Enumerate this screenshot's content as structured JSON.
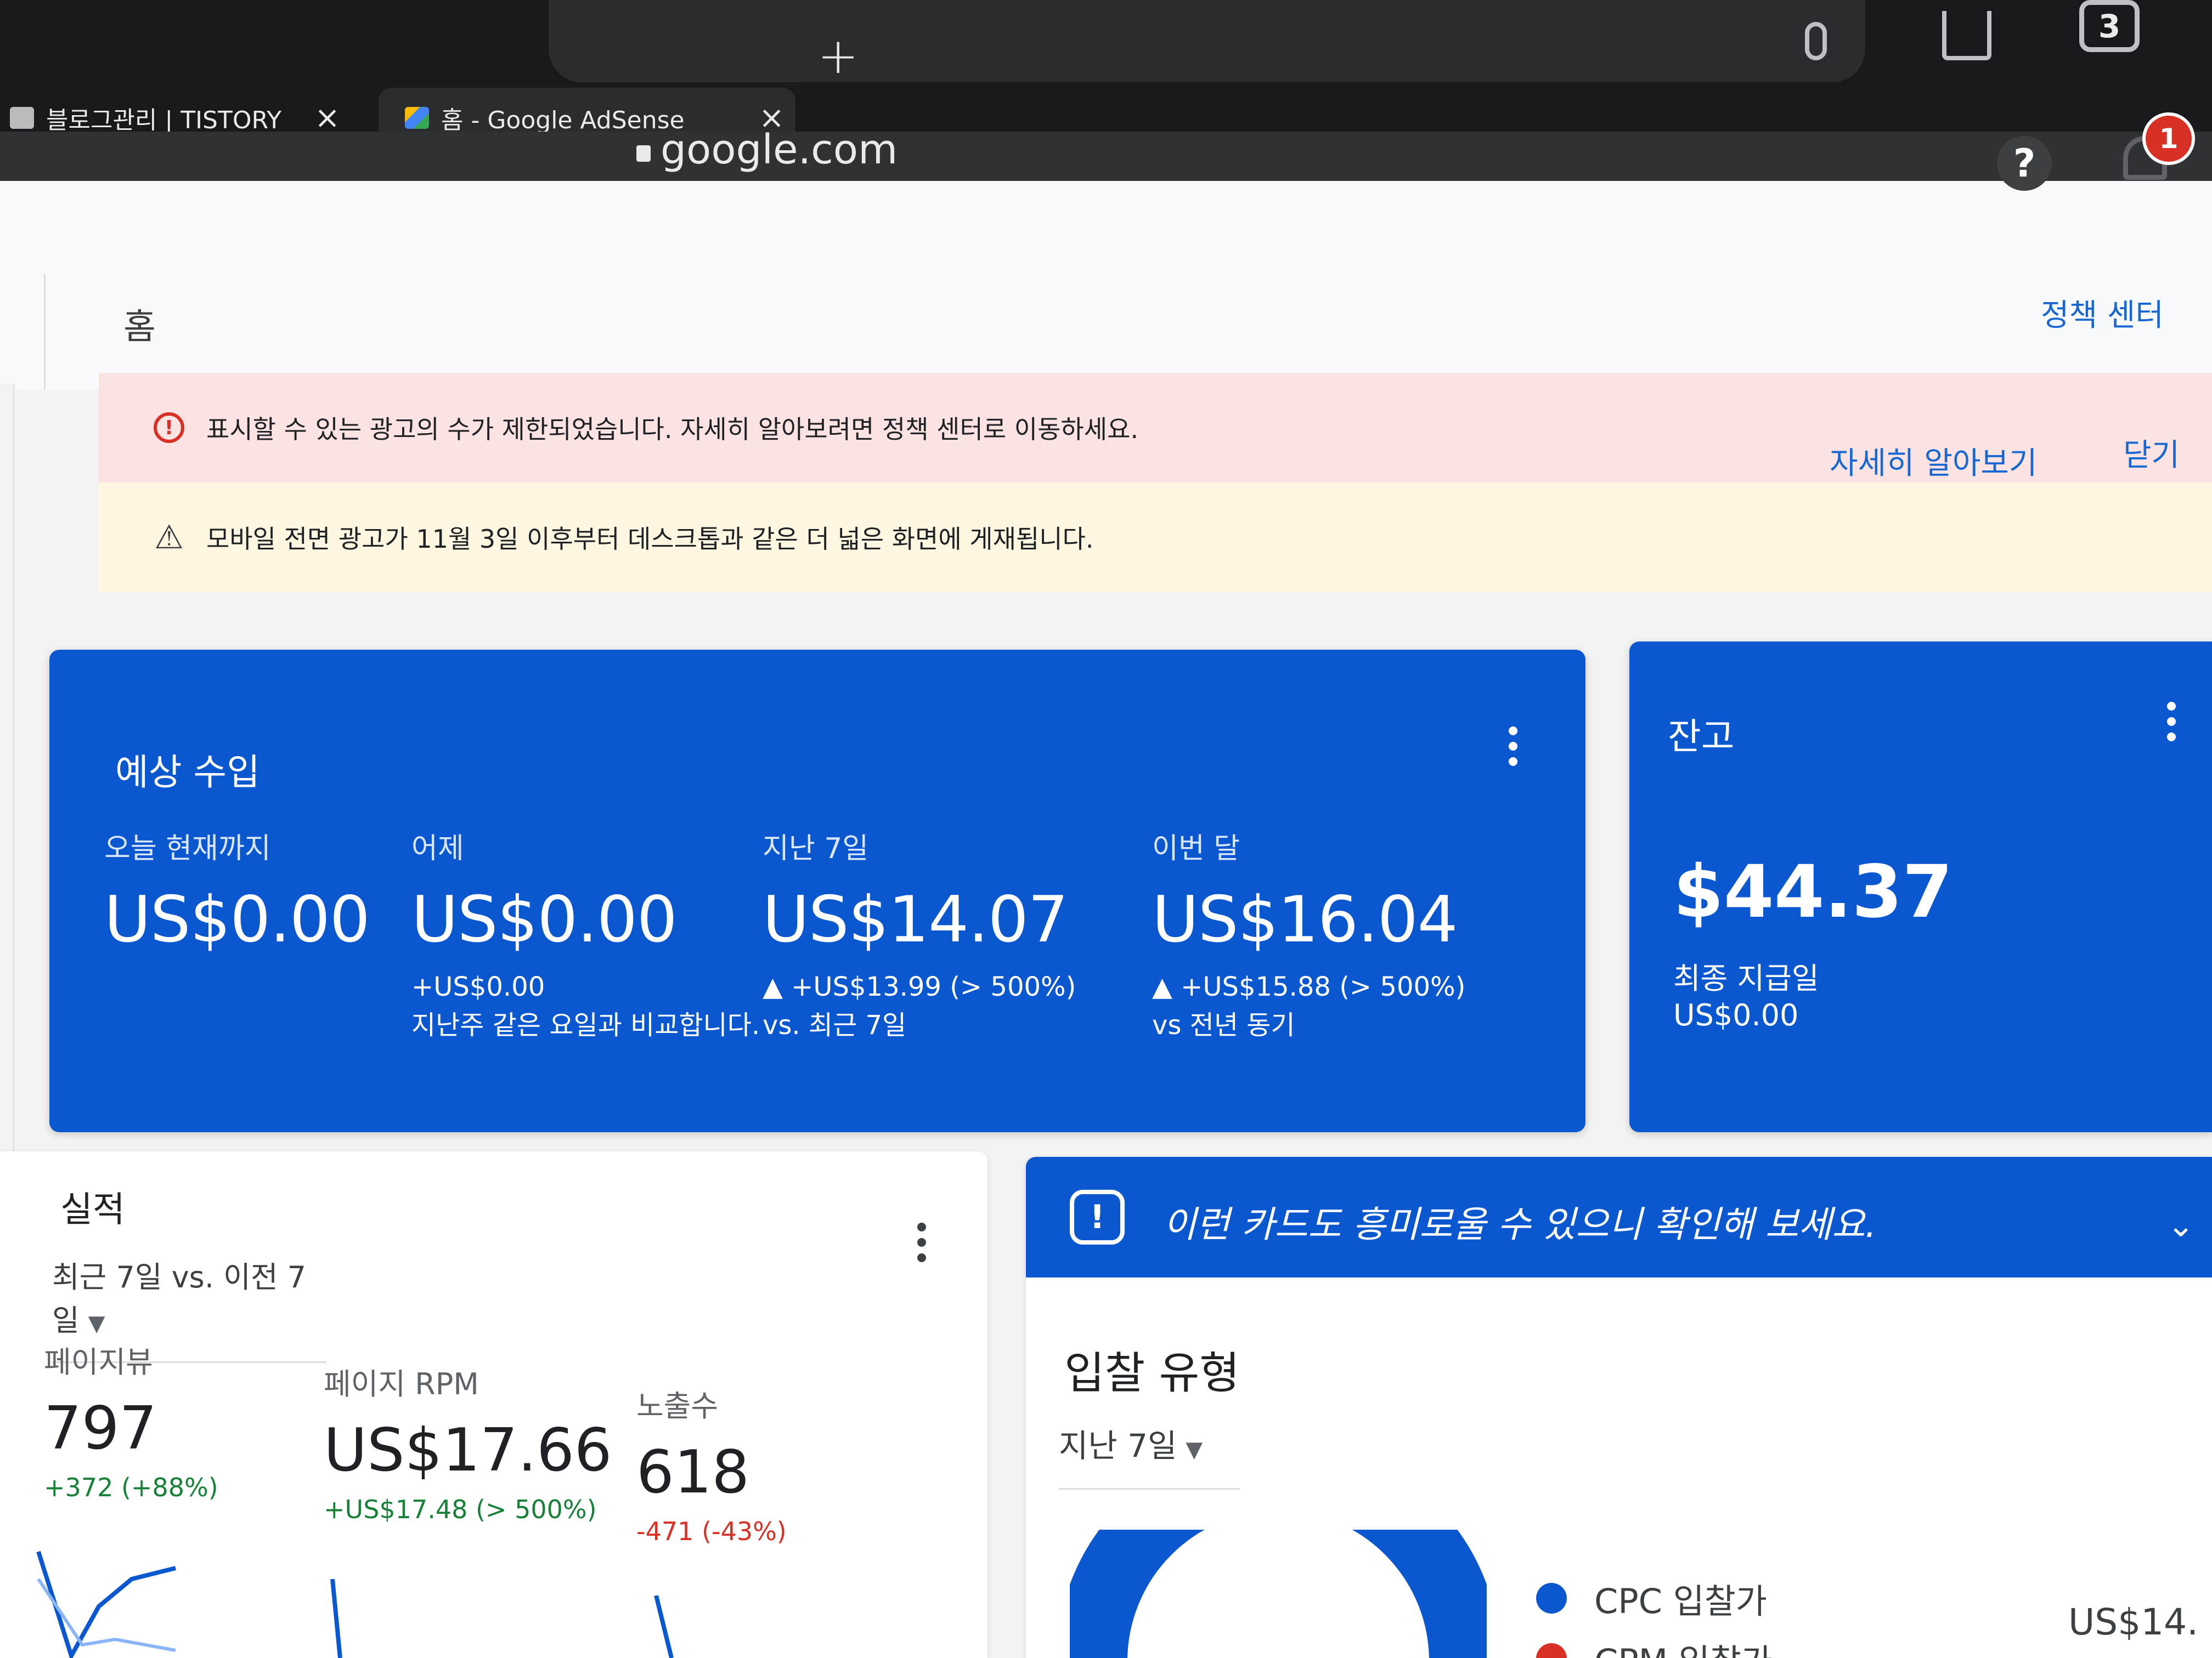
{
  "browser": {
    "tabs": [
      {
        "title": "블로그관리 | TISTORY"
      },
      {
        "title": "홈 - Google AdSense"
      }
    ],
    "url": "google.com",
    "tab_count": "3"
  },
  "header": {
    "page_title": "홈",
    "policy_center_link": "정책 센터",
    "notification_count": "1"
  },
  "banners": {
    "error_text": "표시할 수 있는 광고의 수가 제한되었습니다. 자세히 알아보려면 정책 센터로 이동하세요.",
    "warning_text": "모바일 전면 광고가 11월 3일 이후부터 데스크톱과 같은 더 넓은 화면에 게재됩니다.",
    "learn_more": "자세히 알아보기",
    "close": "닫기"
  },
  "estimated_earnings": {
    "title": "예상 수입",
    "metrics": [
      {
        "label": "오늘 현재까지",
        "value": "US$0.00",
        "change": "",
        "note": ""
      },
      {
        "label": "어제",
        "value": "US$0.00",
        "change": "+US$0.00",
        "note": "지난주 같은 요일과 비교합니다."
      },
      {
        "label": "지난 7일",
        "value": "US$14.07",
        "change": "▲ +US$13.99 (> 500%)",
        "note": "vs. 최근 7일"
      },
      {
        "label": "이번 달",
        "value": "US$16.04",
        "change": "▲ +US$15.88 (> 500%)",
        "note": "vs 전년 동기"
      }
    ]
  },
  "balance": {
    "title": "잔고",
    "amount": "$44.37",
    "last_payment_label": "최종 지급일",
    "last_payment_value": "US$0.00"
  },
  "performance": {
    "title": "실적",
    "range": "최근 7일 vs. 이전 7일",
    "metrics": [
      {
        "label": "페이지뷰",
        "value": "797",
        "change": "+372 (+88%)",
        "trend": "up"
      },
      {
        "label": "페이지 RPM",
        "value": "US$17.66",
        "change": "+US$17.48 (> 500%)",
        "trend": "up"
      },
      {
        "label": "노출수",
        "value": "618",
        "change": "-471 (-43%)",
        "trend": "down"
      }
    ]
  },
  "suggest_card": {
    "header": "이런 카드도 흥미로울 수 있으니 확인해 보세요.",
    "title": "입찰 유형",
    "range": "지난 7일",
    "legend": [
      {
        "label": "CPC 입찰가",
        "color": "#0b57d0"
      },
      {
        "label": "CPM 입찰가",
        "color": "#d93025"
      }
    ],
    "amount": "US$14.",
    "colors": {
      "primary": "#0b57d0",
      "secondary": "#d93025"
    }
  }
}
